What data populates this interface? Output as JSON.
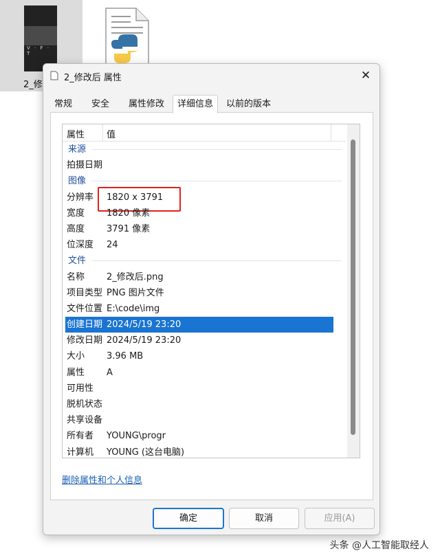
{
  "desktop": {
    "file1_label": "2_修",
    "thumb_text": "V · F · T"
  },
  "dialog": {
    "title": "2_修改后 属性",
    "close_glyph": "✕",
    "tabs": [
      "常规",
      "安全",
      "属性修改",
      "详细信息",
      "以前的版本"
    ],
    "active_tab": "详细信息",
    "columns": {
      "property": "属性",
      "value": "值"
    },
    "rows": [
      {
        "type": "group",
        "label": "来源"
      },
      {
        "type": "item",
        "key": "拍摄日期",
        "value": ""
      },
      {
        "type": "group",
        "label": "图像"
      },
      {
        "type": "item",
        "key": "分辨率",
        "value": "1820 x 3791",
        "highlighted": true
      },
      {
        "type": "item",
        "key": "宽度",
        "value": "1820 像素"
      },
      {
        "type": "item",
        "key": "高度",
        "value": "3791 像素"
      },
      {
        "type": "item",
        "key": "位深度",
        "value": "24"
      },
      {
        "type": "group",
        "label": "文件"
      },
      {
        "type": "item",
        "key": "名称",
        "value": "2_修改后.png"
      },
      {
        "type": "item",
        "key": "项目类型",
        "value": "PNG 图片文件"
      },
      {
        "type": "item",
        "key": "文件位置",
        "value": "E:\\code\\img"
      },
      {
        "type": "item",
        "key": "创建日期",
        "value": "2024/5/19 23:20",
        "selected": true
      },
      {
        "type": "item",
        "key": "修改日期",
        "value": "2024/5/19 23:20"
      },
      {
        "type": "item",
        "key": "大小",
        "value": "3.96 MB"
      },
      {
        "type": "item",
        "key": "属性",
        "value": "A"
      },
      {
        "type": "item",
        "key": "可用性",
        "value": ""
      },
      {
        "type": "item",
        "key": "脱机状态",
        "value": ""
      },
      {
        "type": "item",
        "key": "共享设备",
        "value": ""
      },
      {
        "type": "item",
        "key": "所有者",
        "value": "YOUNG\\progr"
      },
      {
        "type": "item",
        "key": "计算机",
        "value": "YOUNG (这台电脑)"
      }
    ],
    "remove_link": "删除属性和个人信息",
    "buttons": {
      "ok": "确定",
      "cancel": "取消",
      "apply": "应用(A)"
    }
  },
  "watermark": "头条 @人工智能取经人",
  "colors": {
    "selection": "#1a74d1",
    "highlight_box": "#e02020",
    "link": "#1a5fb4",
    "group_label": "#1f4e9c"
  }
}
